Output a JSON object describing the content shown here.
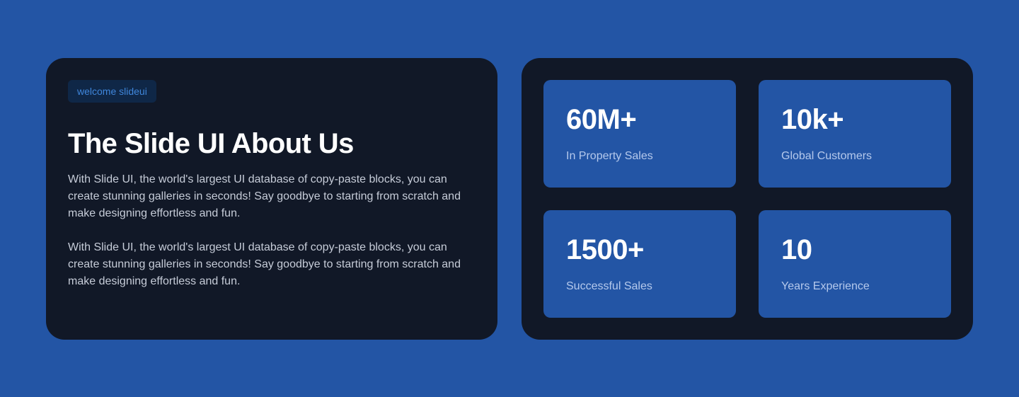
{
  "about": {
    "badge": "welcome slideui",
    "title": "The Slide UI About Us",
    "paragraphs": [
      "With Slide UI, the world's largest UI database of copy-paste blocks, you can create stunning galleries in seconds! Say goodbye to starting from scratch and make designing effortless and fun.",
      "With Slide UI, the world's largest UI database of copy-paste blocks, you can create stunning galleries in seconds! Say goodbye to starting from scratch and make designing effortless and fun."
    ]
  },
  "stats": [
    {
      "value": "60M+",
      "label": "In Property Sales"
    },
    {
      "value": "10k+",
      "label": "Global Customers"
    },
    {
      "value": "1500+",
      "label": "Successful Sales"
    },
    {
      "value": "10",
      "label": "Years Experience"
    }
  ],
  "colors": {
    "background": "#2355a5",
    "card": "#111827",
    "stat_tile": "#2355a5",
    "badge_bg": "#0f2747",
    "badge_text": "#3f86db"
  }
}
